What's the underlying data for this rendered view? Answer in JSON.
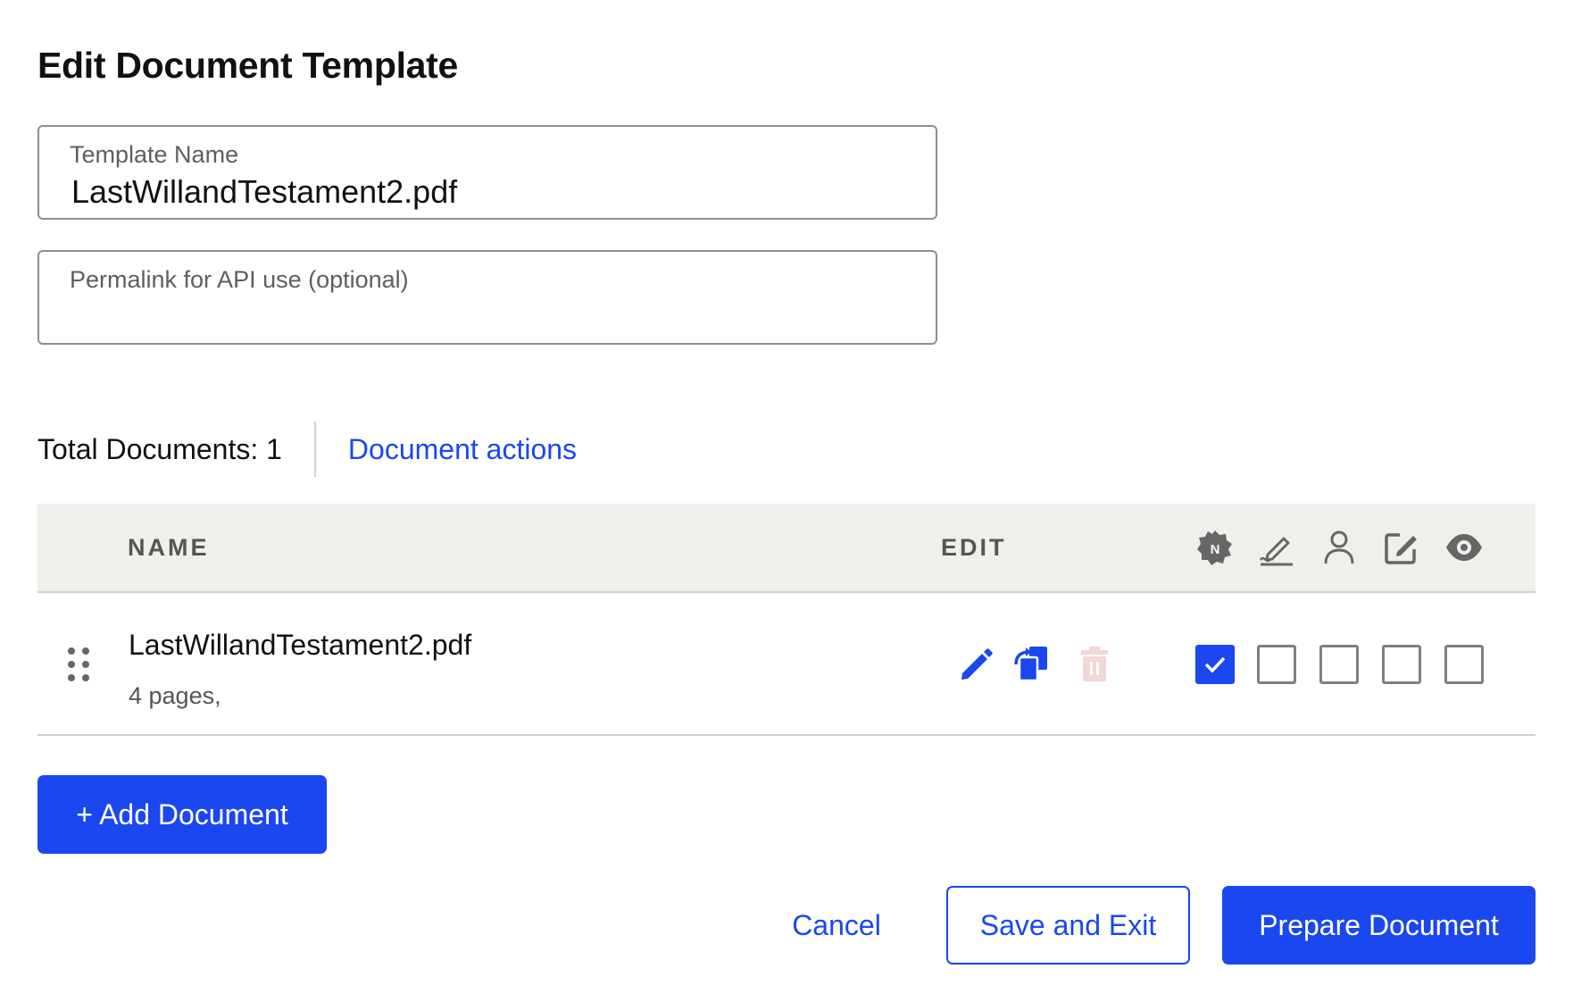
{
  "page": {
    "title": "Edit Document Template"
  },
  "form": {
    "template_name": {
      "label": "Template Name",
      "value": "LastWillandTestament2.pdf"
    },
    "permalink": {
      "label": "Permalink for API use (optional)",
      "value": ""
    }
  },
  "summary": {
    "total_label": "Total Documents: 1",
    "actions_label": "Document actions"
  },
  "table": {
    "headers": {
      "name": "NAME",
      "edit": "EDIT"
    },
    "header_icons": [
      "notary-badge-icon",
      "signature-icon",
      "person-icon",
      "edit-note-icon",
      "eye-icon"
    ],
    "rows": [
      {
        "name": "LastWillandTestament2.pdf",
        "pages": "4 pages,",
        "actions": [
          "pencil-icon",
          "copy-icon",
          "trash-icon"
        ],
        "checks": [
          true,
          false,
          false,
          false,
          false
        ]
      }
    ]
  },
  "buttons": {
    "add_document": "+ Add Document",
    "cancel": "Cancel",
    "save_exit": "Save and Exit",
    "prepare": "Prepare Document"
  },
  "colors": {
    "accent": "#1a47f0",
    "header_bg": "#efefeb",
    "trash_disabled": "#f3d6d6"
  }
}
